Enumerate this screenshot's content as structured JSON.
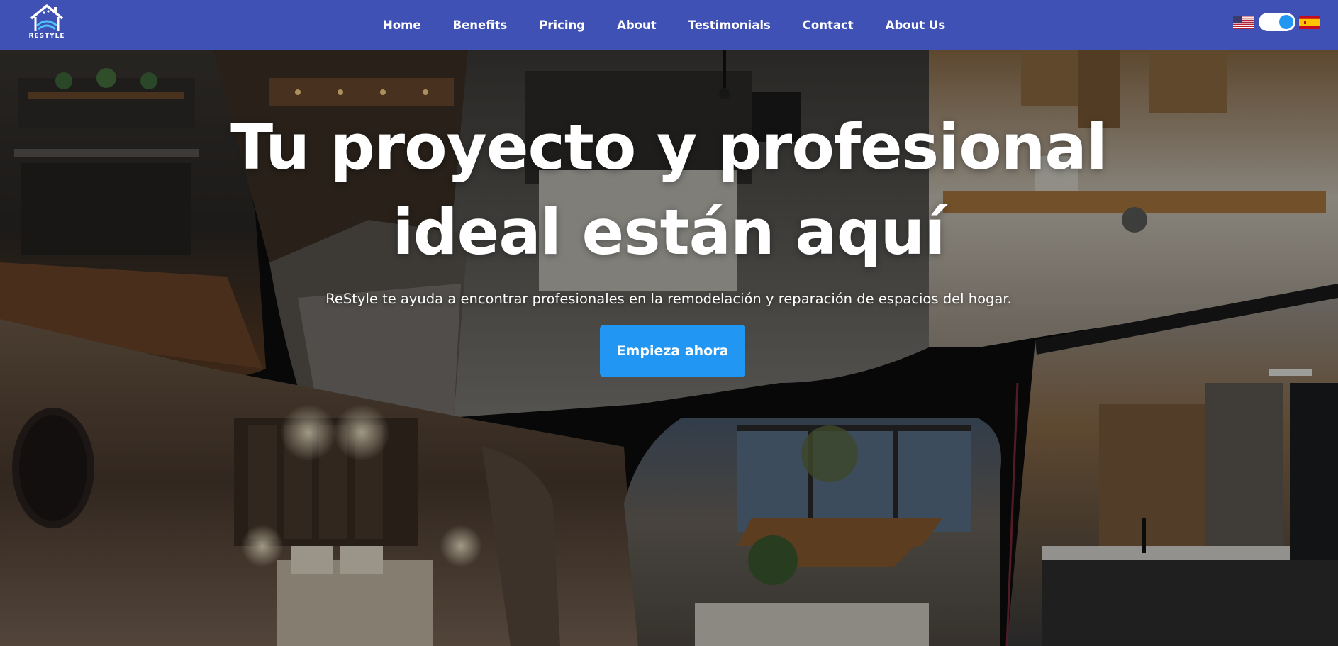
{
  "brand": {
    "logo_text": "RESTYLE",
    "primary_color": "#3f51b5",
    "accent_color": "#2196f3"
  },
  "nav": {
    "items": [
      {
        "label": "Home"
      },
      {
        "label": "Benefits"
      },
      {
        "label": "Pricing"
      },
      {
        "label": "About"
      },
      {
        "label": "Testimonials"
      },
      {
        "label": "Contact"
      },
      {
        "label": "About Us"
      }
    ]
  },
  "language": {
    "left_flag": "us-flag-icon",
    "right_flag": "spain-flag-icon",
    "toggle_state": "on"
  },
  "hero": {
    "title_line1": "Tu proyecto y profesional",
    "title_line2": "ideal están aquí",
    "subtitle": "ReStyle te ayuda a encontrar profesionales en la remodelación y reparación de espacios del hogar.",
    "cta_label": "Empieza ahora"
  }
}
